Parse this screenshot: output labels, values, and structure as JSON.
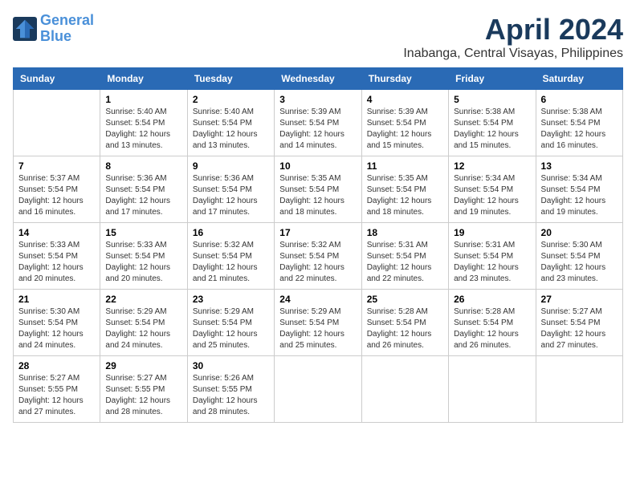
{
  "header": {
    "logo_line1": "General",
    "logo_line2": "Blue",
    "month": "April 2024",
    "location": "Inabanga, Central Visayas, Philippines"
  },
  "weekdays": [
    "Sunday",
    "Monday",
    "Tuesday",
    "Wednesday",
    "Thursday",
    "Friday",
    "Saturday"
  ],
  "weeks": [
    [
      {
        "day": "",
        "sunrise": "",
        "sunset": "",
        "daylight": ""
      },
      {
        "day": "1",
        "sunrise": "Sunrise: 5:40 AM",
        "sunset": "Sunset: 5:54 PM",
        "daylight": "Daylight: 12 hours and 13 minutes."
      },
      {
        "day": "2",
        "sunrise": "Sunrise: 5:40 AM",
        "sunset": "Sunset: 5:54 PM",
        "daylight": "Daylight: 12 hours and 13 minutes."
      },
      {
        "day": "3",
        "sunrise": "Sunrise: 5:39 AM",
        "sunset": "Sunset: 5:54 PM",
        "daylight": "Daylight: 12 hours and 14 minutes."
      },
      {
        "day": "4",
        "sunrise": "Sunrise: 5:39 AM",
        "sunset": "Sunset: 5:54 PM",
        "daylight": "Daylight: 12 hours and 15 minutes."
      },
      {
        "day": "5",
        "sunrise": "Sunrise: 5:38 AM",
        "sunset": "Sunset: 5:54 PM",
        "daylight": "Daylight: 12 hours and 15 minutes."
      },
      {
        "day": "6",
        "sunrise": "Sunrise: 5:38 AM",
        "sunset": "Sunset: 5:54 PM",
        "daylight": "Daylight: 12 hours and 16 minutes."
      }
    ],
    [
      {
        "day": "7",
        "sunrise": "Sunrise: 5:37 AM",
        "sunset": "Sunset: 5:54 PM",
        "daylight": "Daylight: 12 hours and 16 minutes."
      },
      {
        "day": "8",
        "sunrise": "Sunrise: 5:36 AM",
        "sunset": "Sunset: 5:54 PM",
        "daylight": "Daylight: 12 hours and 17 minutes."
      },
      {
        "day": "9",
        "sunrise": "Sunrise: 5:36 AM",
        "sunset": "Sunset: 5:54 PM",
        "daylight": "Daylight: 12 hours and 17 minutes."
      },
      {
        "day": "10",
        "sunrise": "Sunrise: 5:35 AM",
        "sunset": "Sunset: 5:54 PM",
        "daylight": "Daylight: 12 hours and 18 minutes."
      },
      {
        "day": "11",
        "sunrise": "Sunrise: 5:35 AM",
        "sunset": "Sunset: 5:54 PM",
        "daylight": "Daylight: 12 hours and 18 minutes."
      },
      {
        "day": "12",
        "sunrise": "Sunrise: 5:34 AM",
        "sunset": "Sunset: 5:54 PM",
        "daylight": "Daylight: 12 hours and 19 minutes."
      },
      {
        "day": "13",
        "sunrise": "Sunrise: 5:34 AM",
        "sunset": "Sunset: 5:54 PM",
        "daylight": "Daylight: 12 hours and 19 minutes."
      }
    ],
    [
      {
        "day": "14",
        "sunrise": "Sunrise: 5:33 AM",
        "sunset": "Sunset: 5:54 PM",
        "daylight": "Daylight: 12 hours and 20 minutes."
      },
      {
        "day": "15",
        "sunrise": "Sunrise: 5:33 AM",
        "sunset": "Sunset: 5:54 PM",
        "daylight": "Daylight: 12 hours and 20 minutes."
      },
      {
        "day": "16",
        "sunrise": "Sunrise: 5:32 AM",
        "sunset": "Sunset: 5:54 PM",
        "daylight": "Daylight: 12 hours and 21 minutes."
      },
      {
        "day": "17",
        "sunrise": "Sunrise: 5:32 AM",
        "sunset": "Sunset: 5:54 PM",
        "daylight": "Daylight: 12 hours and 22 minutes."
      },
      {
        "day": "18",
        "sunrise": "Sunrise: 5:31 AM",
        "sunset": "Sunset: 5:54 PM",
        "daylight": "Daylight: 12 hours and 22 minutes."
      },
      {
        "day": "19",
        "sunrise": "Sunrise: 5:31 AM",
        "sunset": "Sunset: 5:54 PM",
        "daylight": "Daylight: 12 hours and 23 minutes."
      },
      {
        "day": "20",
        "sunrise": "Sunrise: 5:30 AM",
        "sunset": "Sunset: 5:54 PM",
        "daylight": "Daylight: 12 hours and 23 minutes."
      }
    ],
    [
      {
        "day": "21",
        "sunrise": "Sunrise: 5:30 AM",
        "sunset": "Sunset: 5:54 PM",
        "daylight": "Daylight: 12 hours and 24 minutes."
      },
      {
        "day": "22",
        "sunrise": "Sunrise: 5:29 AM",
        "sunset": "Sunset: 5:54 PM",
        "daylight": "Daylight: 12 hours and 24 minutes."
      },
      {
        "day": "23",
        "sunrise": "Sunrise: 5:29 AM",
        "sunset": "Sunset: 5:54 PM",
        "daylight": "Daylight: 12 hours and 25 minutes."
      },
      {
        "day": "24",
        "sunrise": "Sunrise: 5:29 AM",
        "sunset": "Sunset: 5:54 PM",
        "daylight": "Daylight: 12 hours and 25 minutes."
      },
      {
        "day": "25",
        "sunrise": "Sunrise: 5:28 AM",
        "sunset": "Sunset: 5:54 PM",
        "daylight": "Daylight: 12 hours and 26 minutes."
      },
      {
        "day": "26",
        "sunrise": "Sunrise: 5:28 AM",
        "sunset": "Sunset: 5:54 PM",
        "daylight": "Daylight: 12 hours and 26 minutes."
      },
      {
        "day": "27",
        "sunrise": "Sunrise: 5:27 AM",
        "sunset": "Sunset: 5:54 PM",
        "daylight": "Daylight: 12 hours and 27 minutes."
      }
    ],
    [
      {
        "day": "28",
        "sunrise": "Sunrise: 5:27 AM",
        "sunset": "Sunset: 5:55 PM",
        "daylight": "Daylight: 12 hours and 27 minutes."
      },
      {
        "day": "29",
        "sunrise": "Sunrise: 5:27 AM",
        "sunset": "Sunset: 5:55 PM",
        "daylight": "Daylight: 12 hours and 28 minutes."
      },
      {
        "day": "30",
        "sunrise": "Sunrise: 5:26 AM",
        "sunset": "Sunset: 5:55 PM",
        "daylight": "Daylight: 12 hours and 28 minutes."
      },
      {
        "day": "",
        "sunrise": "",
        "sunset": "",
        "daylight": ""
      },
      {
        "day": "",
        "sunrise": "",
        "sunset": "",
        "daylight": ""
      },
      {
        "day": "",
        "sunrise": "",
        "sunset": "",
        "daylight": ""
      },
      {
        "day": "",
        "sunrise": "",
        "sunset": "",
        "daylight": ""
      }
    ]
  ]
}
